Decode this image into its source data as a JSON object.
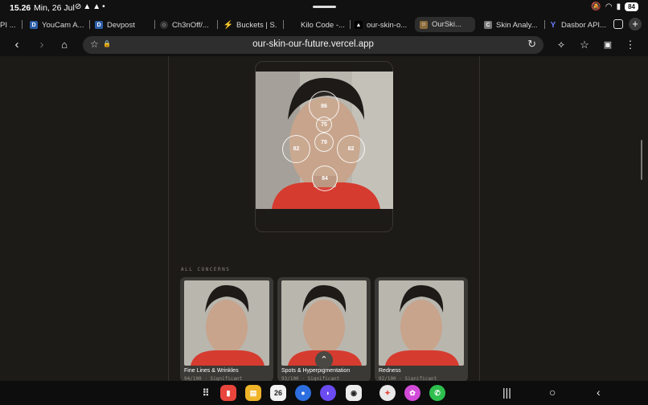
{
  "status": {
    "time": "15.26",
    "date": "Min, 26 Jul",
    "battery": "84"
  },
  "tabs": [
    {
      "label": "PI ...",
      "icon": "partial-tab-icon",
      "color": "#555"
    },
    {
      "label": "YouCam A...",
      "icon": "devpost-d-icon",
      "color": "#2c5fa8"
    },
    {
      "label": "Devpost",
      "icon": "devpost-d-icon",
      "color": "#2c5fa8"
    },
    {
      "label": "Ch3nOff/...",
      "icon": "github-icon",
      "color": "#333"
    },
    {
      "label": "Buckets | S...",
      "icon": "supabase-icon",
      "color": "#3ecf8e"
    },
    {
      "label": "Kilo Code -...",
      "icon": "kilo-icon",
      "color": "#444"
    },
    {
      "label": "our-skin-o...",
      "icon": "vercel-triangle-icon",
      "color": "#000"
    },
    {
      "label": "OurSki...",
      "icon": "ourskin-icon",
      "color": "#8a6b3a",
      "active": true
    },
    {
      "label": "Skin Analy...",
      "icon": "c-icon",
      "color": "#777"
    },
    {
      "label": "Dasbor API...",
      "icon": "y-icon",
      "color": "#3b4bd8"
    }
  ],
  "tab_count": "",
  "url": "our-skin-our-future.vercel.app",
  "zones": [
    {
      "score": "86",
      "label": "forehead"
    },
    {
      "score": "75",
      "label": "nose-bridge"
    },
    {
      "score": "79",
      "label": "nose"
    },
    {
      "score": "82",
      "label": "left-cheek"
    },
    {
      "score": "82",
      "label": "right-cheek"
    },
    {
      "score": "84",
      "label": "chin"
    }
  ],
  "section_label": "ALL CONCERNS",
  "concerns": [
    {
      "name": "Fine Lines & Wrinkles",
      "score": "94/100 · Significant"
    },
    {
      "name": "Spots & Hyperpigmentation",
      "score": "93/100 · Significant"
    },
    {
      "name": "Redness",
      "score": "92/100 · Significant"
    }
  ],
  "dock": {
    "calendar_day": "26"
  },
  "colors": {
    "background": "#1d1b17",
    "card": "#3b3935",
    "shirt": "#d63b2f"
  }
}
